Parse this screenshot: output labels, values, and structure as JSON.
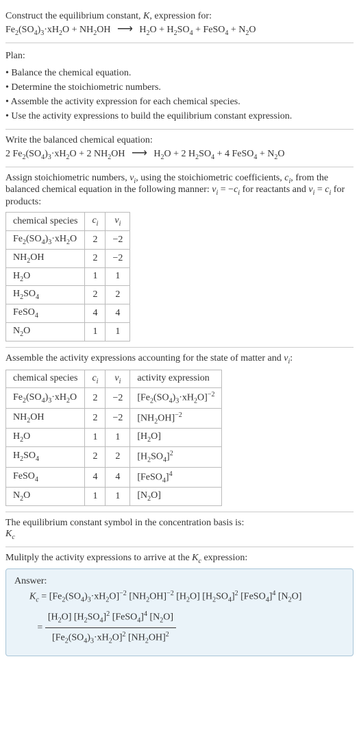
{
  "header": {
    "line1_a": "Construct the equilibrium constant, ",
    "line1_k": "K",
    "line1_b": ", expression for:",
    "eq_lhs1": "Fe",
    "eq_lhs1s": "2",
    "eq_lhs2": "(SO",
    "eq_lhs2s": "4",
    "eq_lhs3": ")",
    "eq_lhs3s": "3",
    "eq_lhs4": "·xH",
    "eq_lhs4s": "2",
    "eq_lhs5": "O + NH",
    "eq_lhs5s": "2",
    "eq_lhs6": "OH",
    "arrow": "⟶",
    "eq_rhs1": "H",
    "eq_rhs1s": "2",
    "eq_rhs2": "O + H",
    "eq_rhs2s": "2",
    "eq_rhs3": "SO",
    "eq_rhs3s": "4",
    "eq_rhs4": " + FeSO",
    "eq_rhs4s": "4",
    "eq_rhs5": " + N",
    "eq_rhs5s": "2",
    "eq_rhs6": "O"
  },
  "plan": {
    "title": "Plan:",
    "b1": "Balance the chemical equation.",
    "b2": "Determine the stoichiometric numbers.",
    "b3": "Assemble the activity expression for each chemical species.",
    "b4": "Use the activity expressions to build the equilibrium constant expression."
  },
  "balanced": {
    "title": "Write the balanced chemical equation:",
    "c1": "2 Fe",
    "c1s": "2",
    "c2": "(SO",
    "c2s": "4",
    "c3": ")",
    "c3s": "3",
    "c4": "·xH",
    "c4s": "2",
    "c5": "O + 2 NH",
    "c5s": "2",
    "c6": "OH",
    "arrow": "⟶",
    "r1": "H",
    "r1s": "2",
    "r2": "O + 2 H",
    "r2s": "2",
    "r3": "SO",
    "r3s": "4",
    "r4": " + 4 FeSO",
    "r4s": "4",
    "r5": " + N",
    "r5s": "2",
    "r6": "O"
  },
  "assign": {
    "p1": "Assign stoichiometric numbers, ",
    "nu": "ν",
    "i": "i",
    "p2": ", using the stoichiometric coefficients, ",
    "c": "c",
    "p3": ", from the balanced chemical equation in the following manner: ",
    "eq1a": "ν",
    "eq1b": " = −",
    "eq1c": "c",
    "p4": " for reactants and ",
    "eq2a": "ν",
    "eq2b": " = ",
    "eq2c": "c",
    "p5": " for products:"
  },
  "table1": {
    "h1": "chemical species",
    "h2": "c",
    "h2i": "i",
    "h3": "ν",
    "h3i": "i",
    "rows": [
      {
        "sp_a": "Fe",
        "sp_as": "2",
        "sp_b": "(SO",
        "sp_bs": "4",
        "sp_c": ")",
        "sp_cs": "3",
        "sp_d": "·xH",
        "sp_ds": "2",
        "sp_e": "O",
        "c": "2",
        "nu": "−2"
      },
      {
        "sp_a": "NH",
        "sp_as": "2",
        "sp_b": "OH",
        "sp_bs": "",
        "sp_c": "",
        "sp_cs": "",
        "sp_d": "",
        "sp_ds": "",
        "sp_e": "",
        "c": "2",
        "nu": "−2"
      },
      {
        "sp_a": "H",
        "sp_as": "2",
        "sp_b": "O",
        "sp_bs": "",
        "sp_c": "",
        "sp_cs": "",
        "sp_d": "",
        "sp_ds": "",
        "sp_e": "",
        "c": "1",
        "nu": "1"
      },
      {
        "sp_a": "H",
        "sp_as": "2",
        "sp_b": "SO",
        "sp_bs": "4",
        "sp_c": "",
        "sp_cs": "",
        "sp_d": "",
        "sp_ds": "",
        "sp_e": "",
        "c": "2",
        "nu": "2"
      },
      {
        "sp_a": "FeSO",
        "sp_as": "4",
        "sp_b": "",
        "sp_bs": "",
        "sp_c": "",
        "sp_cs": "",
        "sp_d": "",
        "sp_ds": "",
        "sp_e": "",
        "c": "4",
        "nu": "4"
      },
      {
        "sp_a": "N",
        "sp_as": "2",
        "sp_b": "O",
        "sp_bs": "",
        "sp_c": "",
        "sp_cs": "",
        "sp_d": "",
        "sp_ds": "",
        "sp_e": "",
        "c": "1",
        "nu": "1"
      }
    ]
  },
  "assemble": {
    "p1": "Assemble the activity expressions accounting for the state of matter and ",
    "nu": "ν",
    "i": "i",
    "p2": ":"
  },
  "table2": {
    "h1": "chemical species",
    "h2": "c",
    "h2i": "i",
    "h3": "ν",
    "h3i": "i",
    "h4": "activity expression",
    "rows": [
      {
        "sp_a": "Fe",
        "sp_as": "2",
        "sp_b": "(SO",
        "sp_bs": "4",
        "sp_c": ")",
        "sp_cs": "3",
        "sp_d": "·xH",
        "sp_ds": "2",
        "sp_e": "O",
        "c": "2",
        "nu": "−2",
        "ae_a": "[Fe",
        "ae_as": "2",
        "ae_b": "(SO",
        "ae_bs": "4",
        "ae_c": ")",
        "ae_cs": "3",
        "ae_d": "·xH",
        "ae_ds": "2",
        "ae_e": "O]",
        "ae_exp": "−2"
      },
      {
        "sp_a": "NH",
        "sp_as": "2",
        "sp_b": "OH",
        "sp_bs": "",
        "sp_c": "",
        "sp_cs": "",
        "sp_d": "",
        "sp_ds": "",
        "sp_e": "",
        "c": "2",
        "nu": "−2",
        "ae_a": "[NH",
        "ae_as": "2",
        "ae_b": "OH]",
        "ae_bs": "",
        "ae_c": "",
        "ae_cs": "",
        "ae_d": "",
        "ae_ds": "",
        "ae_e": "",
        "ae_exp": "−2"
      },
      {
        "sp_a": "H",
        "sp_as": "2",
        "sp_b": "O",
        "sp_bs": "",
        "sp_c": "",
        "sp_cs": "",
        "sp_d": "",
        "sp_ds": "",
        "sp_e": "",
        "c": "1",
        "nu": "1",
        "ae_a": "[H",
        "ae_as": "2",
        "ae_b": "O]",
        "ae_bs": "",
        "ae_c": "",
        "ae_cs": "",
        "ae_d": "",
        "ae_ds": "",
        "ae_e": "",
        "ae_exp": ""
      },
      {
        "sp_a": "H",
        "sp_as": "2",
        "sp_b": "SO",
        "sp_bs": "4",
        "sp_c": "",
        "sp_cs": "",
        "sp_d": "",
        "sp_ds": "",
        "sp_e": "",
        "c": "2",
        "nu": "2",
        "ae_a": "[H",
        "ae_as": "2",
        "ae_b": "SO",
        "ae_bs": "4",
        "ae_c": "]",
        "ae_cs": "",
        "ae_d": "",
        "ae_ds": "",
        "ae_e": "",
        "ae_exp": "2"
      },
      {
        "sp_a": "FeSO",
        "sp_as": "4",
        "sp_b": "",
        "sp_bs": "",
        "sp_c": "",
        "sp_cs": "",
        "sp_d": "",
        "sp_ds": "",
        "sp_e": "",
        "c": "4",
        "nu": "4",
        "ae_a": "[FeSO",
        "ae_as": "4",
        "ae_b": "]",
        "ae_bs": "",
        "ae_c": "",
        "ae_cs": "",
        "ae_d": "",
        "ae_ds": "",
        "ae_e": "",
        "ae_exp": "4"
      },
      {
        "sp_a": "N",
        "sp_as": "2",
        "sp_b": "O",
        "sp_bs": "",
        "sp_c": "",
        "sp_cs": "",
        "sp_d": "",
        "sp_ds": "",
        "sp_e": "",
        "c": "1",
        "nu": "1",
        "ae_a": "[N",
        "ae_as": "2",
        "ae_b": "O]",
        "ae_bs": "",
        "ae_c": "",
        "ae_cs": "",
        "ae_d": "",
        "ae_ds": "",
        "ae_e": "",
        "ae_exp": ""
      }
    ]
  },
  "symbol": {
    "p1": "The equilibrium constant symbol in the concentration basis is:",
    "k": "K",
    "c": "c"
  },
  "multiply": {
    "p1": "Mulitply the activity expressions to arrive at the ",
    "k": "K",
    "c": "c",
    "p2": " expression:"
  },
  "answer": {
    "title": "Answer:",
    "kc_k": "K",
    "kc_c": "c",
    "eq": " = ",
    "line1": {
      "t1": "[Fe",
      "t1s": "2",
      "t2": "(SO",
      "t2s": "4",
      "t3": ")",
      "t3s": "3",
      "t4": "·xH",
      "t4s": "2",
      "t5": "O]",
      "t5e": "−2",
      "t6": " [NH",
      "t6s": "2",
      "t7": "OH]",
      "t7e": "−2",
      "t8": " [H",
      "t8s": "2",
      "t9": "O] [H",
      "t9s": "2",
      "t10": "SO",
      "t10s": "4",
      "t11": "]",
      "t11e": "2",
      "t12": " [FeSO",
      "t12s": "4",
      "t13": "]",
      "t13e": "4",
      "t14": " [N",
      "t14s": "2",
      "t15": "O]"
    },
    "num": {
      "t1": "[H",
      "t1s": "2",
      "t2": "O] [H",
      "t2s": "2",
      "t3": "SO",
      "t3s": "4",
      "t4": "]",
      "t4e": "2",
      "t5": " [FeSO",
      "t5s": "4",
      "t6": "]",
      "t6e": "4",
      "t7": " [N",
      "t7s": "2",
      "t8": "O]"
    },
    "den": {
      "t1": "[Fe",
      "t1s": "2",
      "t2": "(SO",
      "t2s": "4",
      "t3": ")",
      "t3s": "3",
      "t4": "·xH",
      "t4s": "2",
      "t5": "O]",
      "t5e": "2",
      "t6": " [NH",
      "t6s": "2",
      "t7": "OH]",
      "t7e": "2"
    }
  }
}
